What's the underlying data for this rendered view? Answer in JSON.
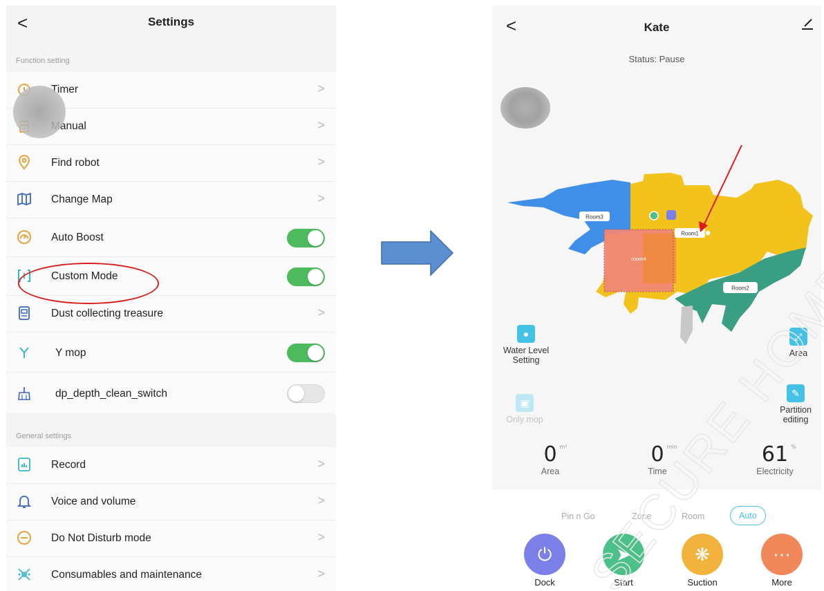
{
  "settings": {
    "back": "<",
    "title": "Settings",
    "section_function": "Function setting",
    "section_general": "General settings",
    "function_items": [
      {
        "label": "Timer",
        "icon": "timer-icon",
        "control": "chevron"
      },
      {
        "label": "Manual",
        "icon": "remote-icon",
        "control": "chevron"
      },
      {
        "label": "Find robot",
        "icon": "location-pin-icon",
        "control": "chevron"
      },
      {
        "label": "Change Map",
        "icon": "map-icon",
        "control": "chevron"
      },
      {
        "label": "Auto Boost",
        "icon": "boost-icon",
        "control": "toggle",
        "on": true
      },
      {
        "label": "Custom Mode",
        "icon": "custom-mode-icon",
        "control": "toggle",
        "on": true
      },
      {
        "label": "Dust collecting treasure",
        "icon": "dust-station-icon",
        "control": "chevron"
      },
      {
        "label": "Y mop",
        "icon": "y-mop-icon",
        "control": "toggle",
        "on": true
      },
      {
        "label": "dp_depth_clean_switch",
        "icon": "broom-icon",
        "control": "toggle",
        "on": false
      }
    ],
    "general_items": [
      {
        "label": "Record",
        "icon": "record-icon",
        "control": "chevron"
      },
      {
        "label": "Voice and volume",
        "icon": "bell-icon",
        "control": "chevron"
      },
      {
        "label": "Do Not Disturb mode",
        "icon": "do-not-disturb-icon",
        "control": "chevron"
      },
      {
        "label": "Consumables and maintenance",
        "icon": "consumables-icon",
        "control": "chevron"
      }
    ],
    "chevron": ">"
  },
  "robot": {
    "back": "<",
    "title": "Kate",
    "status": "Status: Pause",
    "rooms": [
      "Room3",
      "Room1",
      "room4",
      "Room2"
    ],
    "side_buttons": {
      "water_level": "Water Level Setting",
      "only_mop": "Only mop",
      "area": "Area",
      "partition": "Partition editing"
    },
    "stats": [
      {
        "value": "0",
        "unit": "m²",
        "label": "Area"
      },
      {
        "value": "0",
        "unit": "min",
        "label": "Time"
      },
      {
        "value": "61",
        "unit": "%",
        "label": "Electricity"
      }
    ],
    "modes": [
      "Pin n Go",
      "Zone",
      "Room",
      "Auto"
    ],
    "active_mode": "Auto",
    "actions": [
      {
        "label": "Dock",
        "icon": "plug-icon",
        "color": "#7b80e8"
      },
      {
        "label": "Start",
        "icon": "broom-icon",
        "color": "#4cc088"
      },
      {
        "label": "Suction",
        "icon": "fan-icon",
        "color": "#f2b23c"
      },
      {
        "label": "More",
        "icon": "more-icon",
        "color": "#f2885a"
      }
    ]
  },
  "colors": {
    "toggle_on": "#4dba5d",
    "accent": "#45c1e6",
    "highlight_red": "#d62020",
    "arrow_blue": "#5b8fd1",
    "room_yellow": "#f2c21d",
    "room_blue": "#3f8ee8",
    "room_green": "#3a9e82",
    "room_salmon": "#f0877a"
  },
  "watermark_text": "SECURE HOME"
}
